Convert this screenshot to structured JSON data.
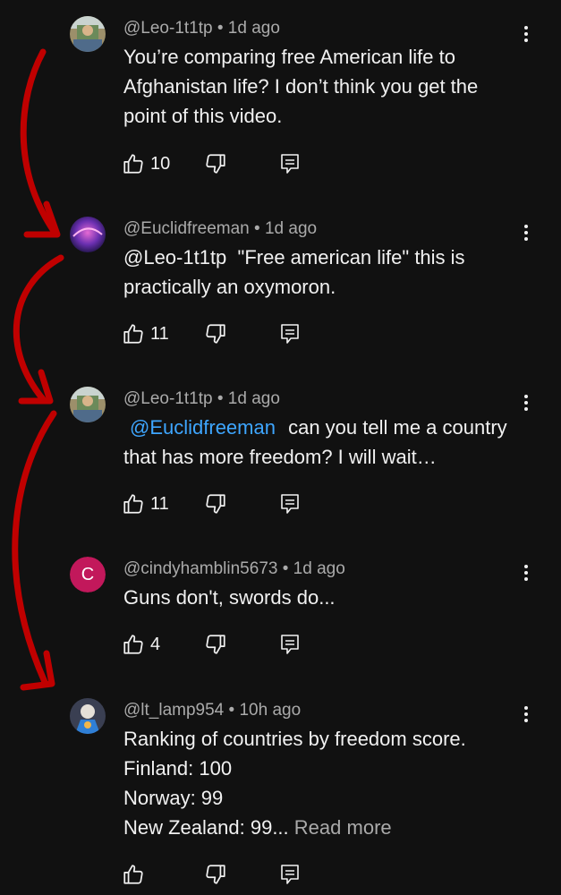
{
  "comments": [
    {
      "author": "@Leo-1t1tp",
      "separator": "•",
      "time": "1d ago",
      "avatar": "avatar-image-leo",
      "lines": [
        {
          "text": "You’re comparing free American life to"
        },
        {
          "text": "Afghanistan life? I don’t think you get the"
        },
        {
          "text": "point of this video."
        }
      ],
      "likes": "10"
    },
    {
      "author": "@Euclidfreeman",
      "separator": "•",
      "time": "1d ago",
      "avatar": "avatar-image-euclid",
      "lines": [
        {
          "text": "@Leo-1t1tp  \"Free american life\" this is"
        },
        {
          "text": "practically an oxymoron."
        }
      ],
      "likes": "11"
    },
    {
      "author": "@Leo-1t1tp",
      "separator": "•",
      "time": "1d ago",
      "avatar": "avatar-image-leo",
      "mention": "@Euclidfreeman",
      "line1_rest": "can you tell me a country",
      "line2": "that has more freedom? I will wait…",
      "likes": "11"
    },
    {
      "author": "@cindyhamblin5673",
      "separator": "•",
      "time": "1d ago",
      "avatar_letter": "C",
      "lines": [
        {
          "text": "Guns don't, swords do..."
        }
      ],
      "likes": "4"
    },
    {
      "author": "@lt_lamp954",
      "separator": "•",
      "time": "10h ago",
      "avatar": "avatar-image-lamp",
      "lines": [
        {
          "text": "Ranking of countries by freedom score."
        },
        {
          "text": "Finland: 100"
        },
        {
          "text": "Norway: 99"
        }
      ],
      "last_line": "New Zealand: 99...",
      "read_more": "Read more",
      "likes": ""
    }
  ],
  "icons": {
    "like": "thumb-up-icon",
    "dislike": "thumb-down-icon",
    "reply": "reply-icon",
    "menu": "more-vertical-icon"
  },
  "colors": {
    "background": "#111111",
    "text": "#f1f1f1",
    "meta": "#aaaaaa",
    "mention": "#3ea6ff",
    "annotation_arrow": "#c00000",
    "avatar_c": "#c2185b"
  }
}
